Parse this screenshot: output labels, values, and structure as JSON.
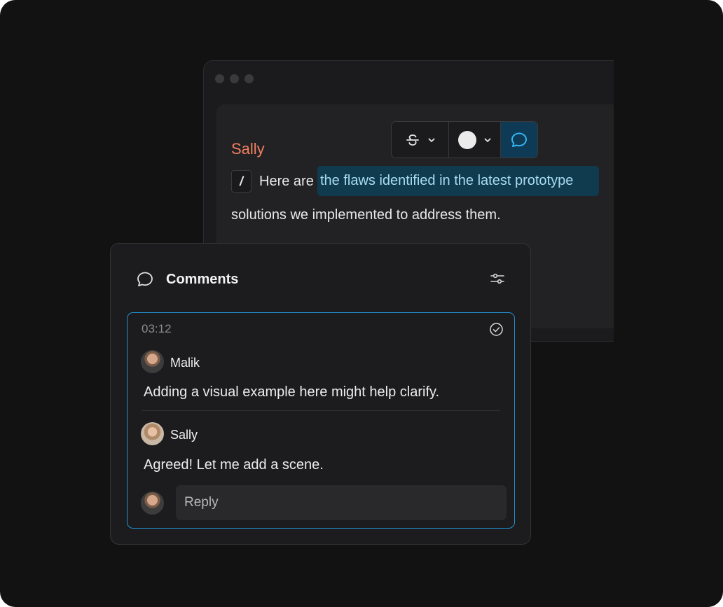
{
  "editor": {
    "author": "Sally",
    "slash_label": "/",
    "line1_prefix": "Here are",
    "highlight_text": "the flaws identified in the latest prototype",
    "line2": "solutions we implemented to address them."
  },
  "toolbar": {
    "strikethrough_icon": "strikethrough-icon",
    "color_swatch": "#ebebeb",
    "comment_icon": "comment-icon"
  },
  "comments": {
    "title": "Comments",
    "thread": {
      "time": "03:12",
      "entries": [
        {
          "name": "Malik",
          "text": "Adding a visual example here might help clarify."
        },
        {
          "name": "Sally",
          "text": "Agreed! Let me add a scene."
        }
      ],
      "reply_placeholder": "Reply"
    }
  },
  "colors": {
    "accent": "#2391d0",
    "author": "#f07f5f",
    "highlight_bg": "#103a4e"
  }
}
